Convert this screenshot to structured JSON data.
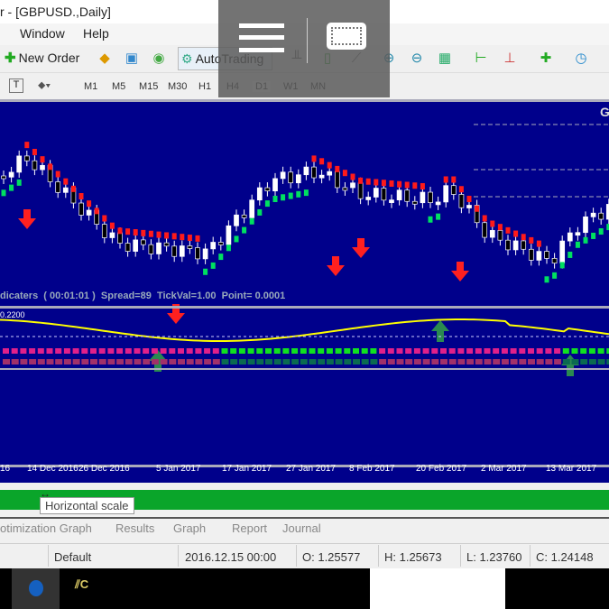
{
  "window": {
    "title": "r - [GBPUSD.,Daily]"
  },
  "menu": {
    "items": [
      "Window",
      "Help"
    ]
  },
  "toolbar": {
    "new_order": "New Order",
    "autotrading": "AutoTrading"
  },
  "timeframes": [
    "M1",
    "M5",
    "M15",
    "M30",
    "H1",
    "H4",
    "D1",
    "W1",
    "MN"
  ],
  "timeframes_active": "D1",
  "chart": {
    "corner_label": "G",
    "info": "dicaters  ( 00:01:01 )  Spread=89  TickVal=1.00  Point= 0.0001",
    "indicator_value": "0.2200",
    "bg_color": "#00008b",
    "up_color": "#00e060",
    "down_color": "#ff1a1a"
  },
  "time_axis": [
    "16",
    "14 Dec 2016",
    "26 Dec 2016",
    "5 Jan 2017",
    "17 Jan 2017",
    "27 Jan 2017",
    "8 Feb 2017",
    "20 Feb 2017",
    "2 Mar 2017",
    "13 Mar 2017"
  ],
  "tooltip": "Horizontal scale",
  "tabs": [
    "otimization Graph",
    "Results",
    "Graph",
    "Report",
    "Journal"
  ],
  "status": {
    "profile": "Default",
    "datetime": "2016.12.15 00:00",
    "open": "O: 1.25577",
    "high": "H: 1.25673",
    "low": "L: 1.23760",
    "close": "C: 1.24148"
  }
}
